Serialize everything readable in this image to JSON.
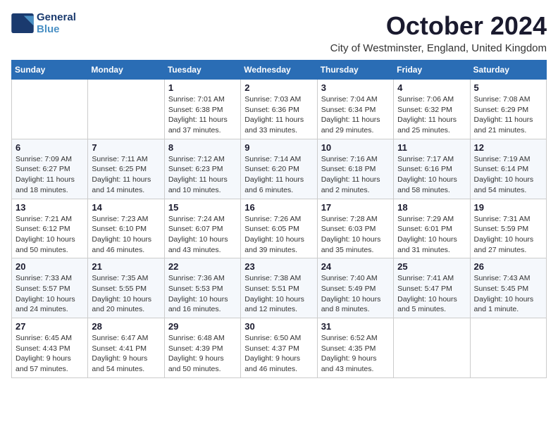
{
  "logo": {
    "line1": "General",
    "line2": "Blue"
  },
  "title": "October 2024",
  "location": "City of Westminster, England, United Kingdom",
  "weekdays": [
    "Sunday",
    "Monday",
    "Tuesday",
    "Wednesday",
    "Thursday",
    "Friday",
    "Saturday"
  ],
  "weeks": [
    [
      {
        "day": "",
        "info": ""
      },
      {
        "day": "",
        "info": ""
      },
      {
        "day": "1",
        "info": "Sunrise: 7:01 AM\nSunset: 6:38 PM\nDaylight: 11 hours and 37 minutes."
      },
      {
        "day": "2",
        "info": "Sunrise: 7:03 AM\nSunset: 6:36 PM\nDaylight: 11 hours and 33 minutes."
      },
      {
        "day": "3",
        "info": "Sunrise: 7:04 AM\nSunset: 6:34 PM\nDaylight: 11 hours and 29 minutes."
      },
      {
        "day": "4",
        "info": "Sunrise: 7:06 AM\nSunset: 6:32 PM\nDaylight: 11 hours and 25 minutes."
      },
      {
        "day": "5",
        "info": "Sunrise: 7:08 AM\nSunset: 6:29 PM\nDaylight: 11 hours and 21 minutes."
      }
    ],
    [
      {
        "day": "6",
        "info": "Sunrise: 7:09 AM\nSunset: 6:27 PM\nDaylight: 11 hours and 18 minutes."
      },
      {
        "day": "7",
        "info": "Sunrise: 7:11 AM\nSunset: 6:25 PM\nDaylight: 11 hours and 14 minutes."
      },
      {
        "day": "8",
        "info": "Sunrise: 7:12 AM\nSunset: 6:23 PM\nDaylight: 11 hours and 10 minutes."
      },
      {
        "day": "9",
        "info": "Sunrise: 7:14 AM\nSunset: 6:20 PM\nDaylight: 11 hours and 6 minutes."
      },
      {
        "day": "10",
        "info": "Sunrise: 7:16 AM\nSunset: 6:18 PM\nDaylight: 11 hours and 2 minutes."
      },
      {
        "day": "11",
        "info": "Sunrise: 7:17 AM\nSunset: 6:16 PM\nDaylight: 10 hours and 58 minutes."
      },
      {
        "day": "12",
        "info": "Sunrise: 7:19 AM\nSunset: 6:14 PM\nDaylight: 10 hours and 54 minutes."
      }
    ],
    [
      {
        "day": "13",
        "info": "Sunrise: 7:21 AM\nSunset: 6:12 PM\nDaylight: 10 hours and 50 minutes."
      },
      {
        "day": "14",
        "info": "Sunrise: 7:23 AM\nSunset: 6:10 PM\nDaylight: 10 hours and 46 minutes."
      },
      {
        "day": "15",
        "info": "Sunrise: 7:24 AM\nSunset: 6:07 PM\nDaylight: 10 hours and 43 minutes."
      },
      {
        "day": "16",
        "info": "Sunrise: 7:26 AM\nSunset: 6:05 PM\nDaylight: 10 hours and 39 minutes."
      },
      {
        "day": "17",
        "info": "Sunrise: 7:28 AM\nSunset: 6:03 PM\nDaylight: 10 hours and 35 minutes."
      },
      {
        "day": "18",
        "info": "Sunrise: 7:29 AM\nSunset: 6:01 PM\nDaylight: 10 hours and 31 minutes."
      },
      {
        "day": "19",
        "info": "Sunrise: 7:31 AM\nSunset: 5:59 PM\nDaylight: 10 hours and 27 minutes."
      }
    ],
    [
      {
        "day": "20",
        "info": "Sunrise: 7:33 AM\nSunset: 5:57 PM\nDaylight: 10 hours and 24 minutes."
      },
      {
        "day": "21",
        "info": "Sunrise: 7:35 AM\nSunset: 5:55 PM\nDaylight: 10 hours and 20 minutes."
      },
      {
        "day": "22",
        "info": "Sunrise: 7:36 AM\nSunset: 5:53 PM\nDaylight: 10 hours and 16 minutes."
      },
      {
        "day": "23",
        "info": "Sunrise: 7:38 AM\nSunset: 5:51 PM\nDaylight: 10 hours and 12 minutes."
      },
      {
        "day": "24",
        "info": "Sunrise: 7:40 AM\nSunset: 5:49 PM\nDaylight: 10 hours and 8 minutes."
      },
      {
        "day": "25",
        "info": "Sunrise: 7:41 AM\nSunset: 5:47 PM\nDaylight: 10 hours and 5 minutes."
      },
      {
        "day": "26",
        "info": "Sunrise: 7:43 AM\nSunset: 5:45 PM\nDaylight: 10 hours and 1 minute."
      }
    ],
    [
      {
        "day": "27",
        "info": "Sunrise: 6:45 AM\nSunset: 4:43 PM\nDaylight: 9 hours and 57 minutes."
      },
      {
        "day": "28",
        "info": "Sunrise: 6:47 AM\nSunset: 4:41 PM\nDaylight: 9 hours and 54 minutes."
      },
      {
        "day": "29",
        "info": "Sunrise: 6:48 AM\nSunset: 4:39 PM\nDaylight: 9 hours and 50 minutes."
      },
      {
        "day": "30",
        "info": "Sunrise: 6:50 AM\nSunset: 4:37 PM\nDaylight: 9 hours and 46 minutes."
      },
      {
        "day": "31",
        "info": "Sunrise: 6:52 AM\nSunset: 4:35 PM\nDaylight: 9 hours and 43 minutes."
      },
      {
        "day": "",
        "info": ""
      },
      {
        "day": "",
        "info": ""
      }
    ]
  ]
}
